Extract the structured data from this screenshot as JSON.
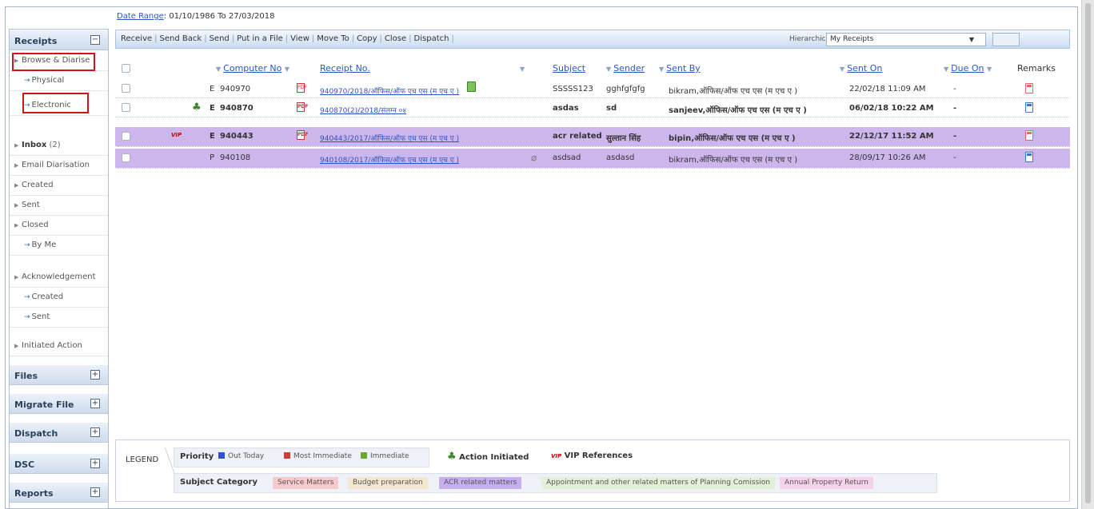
{
  "date_range": {
    "label": "Date Range",
    "value": ": 01/10/1986 To 27/03/2018"
  },
  "toolbar": {
    "actions": [
      "Receive",
      "Send Back",
      "Send",
      "Put in a File",
      "View",
      "Move To",
      "Copy",
      "Close",
      "Dispatch"
    ],
    "hierarchical_label": "Hierarchical View",
    "hierarchical_value": "My Receipts"
  },
  "sidebar": {
    "receipts": "Receipts",
    "receipts_toggle": "−",
    "browse_diarise": "Browse & Diarise",
    "physical": "Physical",
    "electronic": "Electronic",
    "inbox": "Inbox",
    "inbox_count": "(2)",
    "email_diarisation": "Email Diarisation",
    "created": "Created",
    "sent": "Sent",
    "closed": "Closed",
    "by_me": "By Me",
    "acknowledgement": "Acknowledgement",
    "ack_created": "Created",
    "ack_sent": "Sent",
    "initiated_action": "Initiated Action",
    "files": "Files",
    "migrate_file": "Migrate File",
    "dispatch": "Dispatch",
    "dsc": "DSC",
    "reports": "Reports",
    "toggle_plus": "+"
  },
  "table": {
    "headers": {
      "computer_no": "Computer No",
      "receipt_no": "Receipt No.",
      "subject": "Subject",
      "sender": "Sender",
      "sent_by": "Sent By",
      "sent_on": "Sent On",
      "due_on": "Due On",
      "remarks": "Remarks"
    },
    "rows": [
      {
        "type": "E",
        "computer_no": "940970",
        "receipt_no": "940970/2018/ऑफिस/ऑफ एच एस (म एच ए )",
        "subject": "SSSSS123",
        "sender": "gghfgfgfg",
        "sent_by": "bikram,ऑफिस/ऑफ एच एस (म एच ए )",
        "sent_on": "22/02/18 11:09 AM",
        "due_on": "-"
      },
      {
        "type": "E",
        "computer_no": "940870",
        "receipt_no": "940870(2)/2018/संलग्न ०४",
        "subject": "asdas",
        "sender": "sd",
        "sent_by": "sanjeev,ऑफिस/ऑफ एच एस (म एच ए )",
        "sent_on": "06/02/18 10:22 AM",
        "due_on": "-"
      },
      {
        "type": "E",
        "vip": "VIP",
        "computer_no": "940443",
        "receipt_no": "940443/2017/ऑफिस/ऑफ एच एस (म एच ए )",
        "subject": "acr related",
        "sender": "सुल्तान सिंह",
        "sent_by": "bipin,ऑफिस/ऑफ एच एस (म एच ए )",
        "sent_on": "22/12/17 11:52 AM",
        "due_on": "-"
      },
      {
        "type": "P",
        "computer_no": "940108",
        "receipt_no": "940108/2017/ऑफिस/ऑफ एच एस (म एच ए )",
        "subject": "asdsad",
        "sender": "asdasd",
        "sent_by": "bikram,ऑफिस/ऑफ एच एस (म एच ए )",
        "sent_on": "28/09/17 10:26 AM",
        "due_on": "-"
      }
    ]
  },
  "legend": {
    "title": "LEGEND",
    "priority": "Priority",
    "out_today": "Out Today",
    "most_immediate": "Most Immediate",
    "immediate": "Immediate",
    "action_initiated": "Action Initiated",
    "vip_mark": "VIP",
    "vip_references": "VIP References",
    "subject_category": "Subject Category",
    "categories": [
      "Service Matters",
      "Budget preparation",
      "ACR related matters",
      "Appointment and other related matters of Planning Comission",
      "Annual Property Return"
    ]
  },
  "colors": {
    "out_today": "#3452c9",
    "most_immediate": "#d23b3b",
    "immediate": "#6aa832",
    "purple_row": "#cdb6ec",
    "service_matters": "#f9c9cc",
    "budget_preparation": "#f4e6cf",
    "acr_related": "#c7aef1",
    "appointment": "#e3f0d8",
    "annual_property": "#f6d3ea"
  }
}
